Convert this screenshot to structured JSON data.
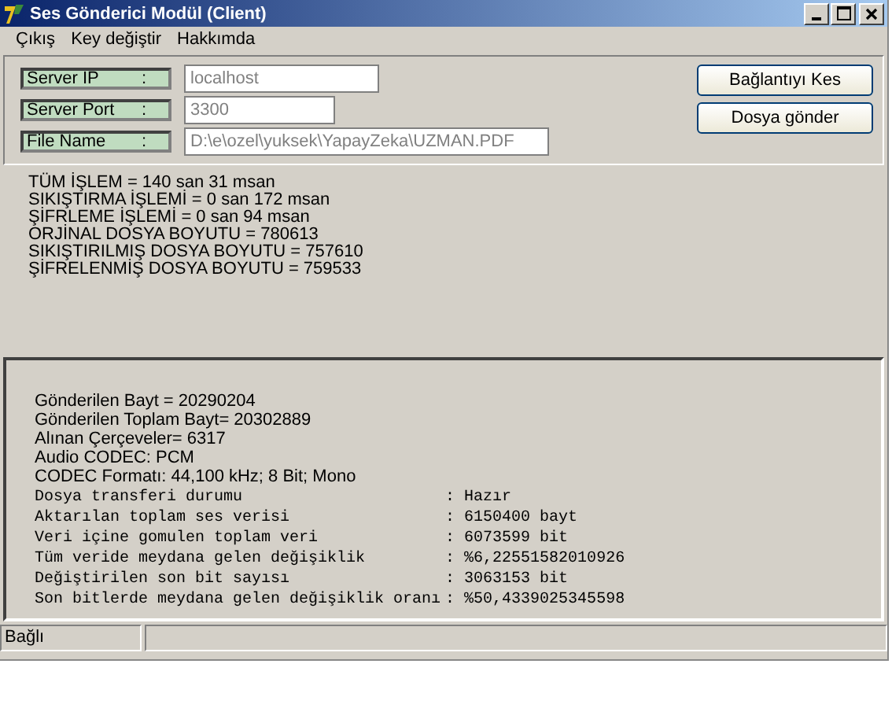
{
  "window": {
    "title": "Ses Gönderici Modül (Client)"
  },
  "menu": [
    "Çıkış",
    "Key değiştir",
    "Hakkımda"
  ],
  "fields": [
    {
      "label": "Server IP",
      "colon": ":",
      "value": "localhost"
    },
    {
      "label": "Server Port",
      "colon": ":",
      "value": "3300"
    },
    {
      "label": "File Name",
      "colon": ":",
      "value": "D:\\e\\ozel\\yuksek\\YapayZeka\\UZMAN.PDF"
    }
  ],
  "buttons": [
    "Bağlantıyı Kes",
    "Dosya gönder"
  ],
  "results": [
    "TÜM İŞLEM = 140 san 31 msan",
    "SIKIŞTIRMA İŞLEMİ = 0 san 172 msan",
    "ŞİFRLEME İŞLEMİ = 0 san 94 msan",
    "ORJİNAL DOSYA BOYUTU = 780613",
    "SIKIŞTIRILMIŞ DOSYA BOYUTU = 757610",
    "ŞİFRELENMİŞ DOSYA BOYUTU = 759533"
  ],
  "transfer_info": [
    "Gönderilen Bayt = 20290204",
    "Gönderilen Toplam Bayt= 20302889",
    "Alınan Çerçeveler= 6317",
    "Audio CODEC: PCM",
    "CODEC Formatı: 44,100 kHz; 8 Bit; Mono"
  ],
  "stats": [
    {
      "label": "Dosya transferi durumu",
      "value": ": Hazır"
    },
    {
      "label": "Aktarılan toplam ses verisi",
      "value": ": 6150400 bayt"
    },
    {
      "label": "Veri içine gomulen toplam veri",
      "value": ": 6073599 bit"
    },
    {
      "label": "Tüm veride meydana gelen değişiklik",
      "value": ": %6,22551582010926"
    },
    {
      "label": "Değiştirilen son bit sayısı",
      "value": ": 3063153 bit"
    },
    {
      "label": "Son bitlerde meydana gelen değişiklik oranı",
      "value": ": %50,4339025345598"
    }
  ],
  "status_bar": "Bağlı"
}
